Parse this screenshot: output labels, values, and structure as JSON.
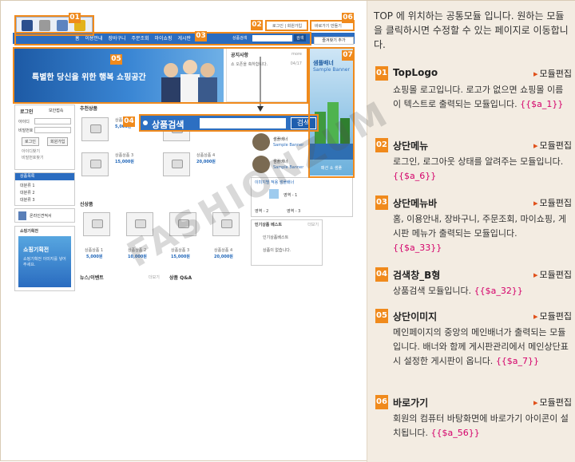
{
  "preview": {
    "nav_items": [
      "홈",
      "이용안내",
      "장바구니",
      "주문조회",
      "마이쇼핑",
      "게시판"
    ],
    "topbar_links": [
      "로그인 | 회원가입",
      "바로가기 만들기"
    ],
    "search_small_label": "상품검색",
    "search_small_button": "검색",
    "banner_text": "특별한 당신을 위한 행복 쇼핑공간",
    "notice_title": "공지사항",
    "notice_more": "more",
    "notice_line": "쇼 오픈을 축하합니다.",
    "notice_date": "04/17",
    "sample_banner_ko": "샘플배너",
    "sample_banner_en": "Sample Banner",
    "favorite_label": "즐겨찾기 추가",
    "login_title": "로그인",
    "secure_label": "보안접속",
    "login_fields": [
      "아이디",
      "비밀번호"
    ],
    "login_buttons": [
      "로그인",
      "회원가입"
    ],
    "login_links": [
      "아이디찾기",
      "비밀번호찾기"
    ],
    "category_title": "상품목록",
    "categories": [
      "대분류 1",
      "대분류 2",
      "대분류 3"
    ],
    "online_quote": "온라인견적서",
    "planning_title": "쇼핑기획전",
    "planning_banner": "쇼핑기획전",
    "planning_desc": "쇼핑기획전 이미지를 넣어주세요.",
    "recommend_title": "추천상품",
    "new_title": "신상품",
    "news_title": "뉴스/이벤트",
    "qna_title": "상품 Q&A",
    "popular_title": "인기상품 베스트",
    "popular_sub": "인기상품베스트",
    "popular_empty": "상품이 없습니다.",
    "today_title": "이미지별 적용 샘플배너",
    "product_labels": [
      "상품상품 1",
      "상품상품 2",
      "상품상품 3",
      "상품상품 4",
      "상품상품 1",
      "상품상품 2",
      "상품상품 3",
      "상품상품 4"
    ],
    "product_prices": [
      "5,000원",
      "15,000원",
      "20,000원",
      "5,000원",
      "10,000원",
      "15,000원",
      "20,000원"
    ],
    "big_search_title": "상품검색",
    "big_search_button": "검색",
    "more_label": "더보기",
    "thumb_text": "상품이미지 준비중",
    "page_items": [
      "영역 - 1",
      "영역 - 2",
      "영역 - 3"
    ],
    "sample_vertical_caption": "패션 쇼 샘플",
    "tag_numbers": [
      "01",
      "02",
      "03",
      "04",
      "05",
      "06",
      "07"
    ]
  },
  "watermark": "FASHIONZUM",
  "intro": "TOP 에 위치하는 공통모듈 입니다. 원하는 모듈을 클릭하시면 수정할 수 있는 페이지로 이동합니다.",
  "edit_label": "모듈편집",
  "sections": [
    {
      "num": "01",
      "title": "TopLogo",
      "desc": "쇼핑몰 로고입니다. 로고가 없으면 쇼핑몰 이름이 텍스트로 출력되는 모듈입니다.",
      "code": "{{$a_1}}"
    },
    {
      "num": "02",
      "title": "상단메뉴",
      "desc": "로그인, 로그아웃 상태를 알려주는 모듈입니다.",
      "code": "{{$a_6}}"
    },
    {
      "num": "03",
      "title": "상단메뉴바",
      "desc": "홈, 이용안내, 장바구니, 주문조회, 마이쇼핑, 게시판 메뉴가 출력되는 모듈입니다.",
      "code": "{{$a_33}}"
    },
    {
      "num": "04",
      "title": "검색창_B형",
      "desc": "상품검색 모듈입니다.",
      "code": "{{$a_32}}"
    },
    {
      "num": "05",
      "title": "상단이미지",
      "desc": "메인페이지의 중앙의 메인배너가 출력되는 모듈입니다. 배너와 함께 게시판관리에서 메인상단표시 설정한 게시판이 옵니다.",
      "code": "{{$a_7}}"
    },
    {
      "num": "06",
      "title": "바로가기",
      "desc": "회원의 컴퓨터 바탕화면에 바로가기 아이콘이 설치됩니다.",
      "code": "{{$a_56}}"
    }
  ],
  "colors": {
    "accent": "#f08a1c",
    "nav_blue": "#2a6cc0",
    "side_bg": "#f3ece2",
    "code": "#d4006a"
  }
}
